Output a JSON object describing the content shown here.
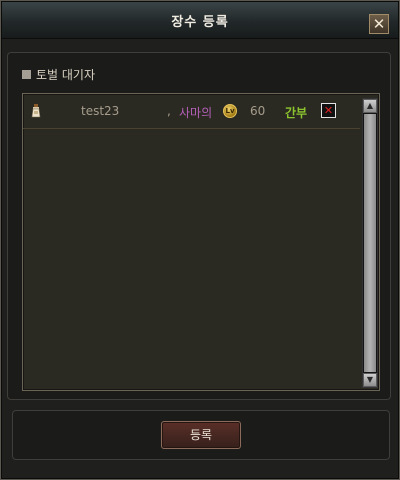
{
  "window": {
    "title": "장수 등록",
    "close_label": "✕"
  },
  "section": {
    "title": "토벌 대기자"
  },
  "list": {
    "rows": [
      {
        "name": "test23",
        "separator": ",",
        "guild": "사마의",
        "level_icon_text": "Lv",
        "level": "60",
        "rank": "간부",
        "delete_label": "✕"
      }
    ]
  },
  "scrollbar": {
    "up_label": "▲",
    "down_label": "▼"
  },
  "footer": {
    "register_label": "등록"
  },
  "colors": {
    "guild": "#b45fb8",
    "rank": "#8dc52f",
    "delete": "#e12020"
  }
}
